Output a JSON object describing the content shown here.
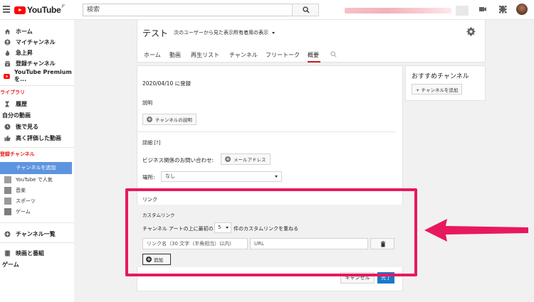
{
  "header": {
    "logo_text": "YouTube",
    "logo_region": "JP",
    "search_placeholder": "検索"
  },
  "sidebar": {
    "main_items": [
      {
        "label": "ホーム",
        "icon": "home-icon"
      },
      {
        "label": "マイチャンネル",
        "icon": "account-icon"
      },
      {
        "label": "急上昇",
        "icon": "flame-icon"
      },
      {
        "label": "登録チャンネル",
        "icon": "subscriptions-icon"
      },
      {
        "label": "YouTube Premium を...",
        "icon": "youtube-premium-icon"
      }
    ],
    "library_heading": "ライブラリ",
    "library_items": [
      {
        "label": "履歴",
        "icon": "hourglass-icon"
      },
      {
        "label": "自分の動画",
        "icon": ""
      },
      {
        "label": "後で見る",
        "icon": "clock-icon"
      },
      {
        "label": "高く評価した動画",
        "icon": "thumb-up-icon"
      }
    ],
    "subscriptions_heading": "登録チャンネル",
    "add_channel_label": "チャンネルを追加",
    "sub_items": [
      {
        "label": "YouTube で人気"
      },
      {
        "label": "音楽"
      },
      {
        "label": "スポーツ"
      },
      {
        "label": "ゲーム"
      }
    ],
    "channel_list_label": "チャンネル一覧",
    "movies_label": "映画と番組",
    "games_label": "ゲーム"
  },
  "channel": {
    "title": "テスト",
    "view_as_label": "次のユーザーから見た表示:",
    "view_as_value": "所有者用の表示",
    "tabs": [
      "ホーム",
      "動画",
      "再生リスト",
      "チャンネル",
      "フリートーク",
      "概要"
    ],
    "active_tab": "概要"
  },
  "about": {
    "joined": "2020/04/10 に登録",
    "description_heading": "説明",
    "description_button": "チャンネルの説明",
    "details_heading": "詳細 [?]",
    "business_label": "ビジネス関係のお問い合わせ:",
    "email_button": "メールアドレス",
    "location_label": "場所:",
    "location_value": "なし",
    "links_heading": "リンク",
    "custom_links_heading": "カスタムリンク",
    "overlay_prefix": "チャンネル アートの上に最初の",
    "overlay_count": "5",
    "overlay_suffix": "件のカスタムリンクを重ねる",
    "link_name_placeholder": "リンク名（30 文字（半角相当）以内）",
    "url_placeholder": "URL",
    "add_button": "追加",
    "cancel_button": "キャンセル",
    "done_button": "完了"
  },
  "recommended": {
    "title": "おすすめチャンネル",
    "add_button": "+ チャンネルを追加"
  },
  "colors": {
    "highlight": "#e8185f",
    "youtube_red": "#ff0000",
    "primary_blue": "#167ac6"
  }
}
